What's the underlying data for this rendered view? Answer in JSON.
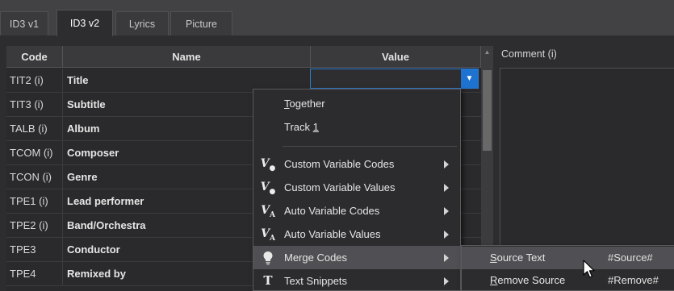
{
  "tabs": [
    {
      "label": "ID3 v1",
      "active": false
    },
    {
      "label": "ID3 v2",
      "active": true
    },
    {
      "label": "Lyrics",
      "active": false
    },
    {
      "label": "Picture",
      "active": false
    }
  ],
  "table": {
    "headers": {
      "code": "Code",
      "name": "Name",
      "value": "Value"
    },
    "rows": [
      {
        "code": "TIT2 (i)",
        "name": "Title"
      },
      {
        "code": "TIT3 (i)",
        "name": "Subtitle"
      },
      {
        "code": "TALB (i)",
        "name": "Album"
      },
      {
        "code": "TCOM (i)",
        "name": "Composer"
      },
      {
        "code": "TCON (i)",
        "name": "Genre"
      },
      {
        "code": "TPE1 (i)",
        "name": "Lead performer"
      },
      {
        "code": "TPE2 (i)",
        "name": "Band/Orchestra"
      },
      {
        "code": "TPE3",
        "name": "Conductor"
      },
      {
        "code": "TPE4",
        "name": "Remixed by"
      }
    ]
  },
  "comment": {
    "label": "Comment (i)"
  },
  "context_menu": {
    "together_first": "T",
    "together_rest": "ogether",
    "track_prefix": "Track ",
    "track_digit": "1",
    "items": [
      {
        "label": "Custom Variable Codes",
        "icon": "custom-variable-codes-icon"
      },
      {
        "label": "Custom Variable Values",
        "icon": "custom-variable-values-icon"
      },
      {
        "label": "Auto Variable Codes",
        "icon": "auto-variable-codes-icon"
      },
      {
        "label": "Auto Variable Values",
        "icon": "auto-variable-values-icon"
      },
      {
        "label": "Merge Codes",
        "icon": "lightbulb-icon"
      },
      {
        "label": "Text Snippets",
        "icon": "text-t-icon"
      }
    ]
  },
  "submenu": {
    "items": [
      {
        "first": "S",
        "rest": "ource Text",
        "code": "#Source#"
      },
      {
        "first": "R",
        "rest": "emove Source",
        "code": "#Remove#"
      }
    ]
  },
  "colors": {
    "accent": "#1d73cf",
    "highlight": "#505054",
    "background": "#2d2d30"
  }
}
